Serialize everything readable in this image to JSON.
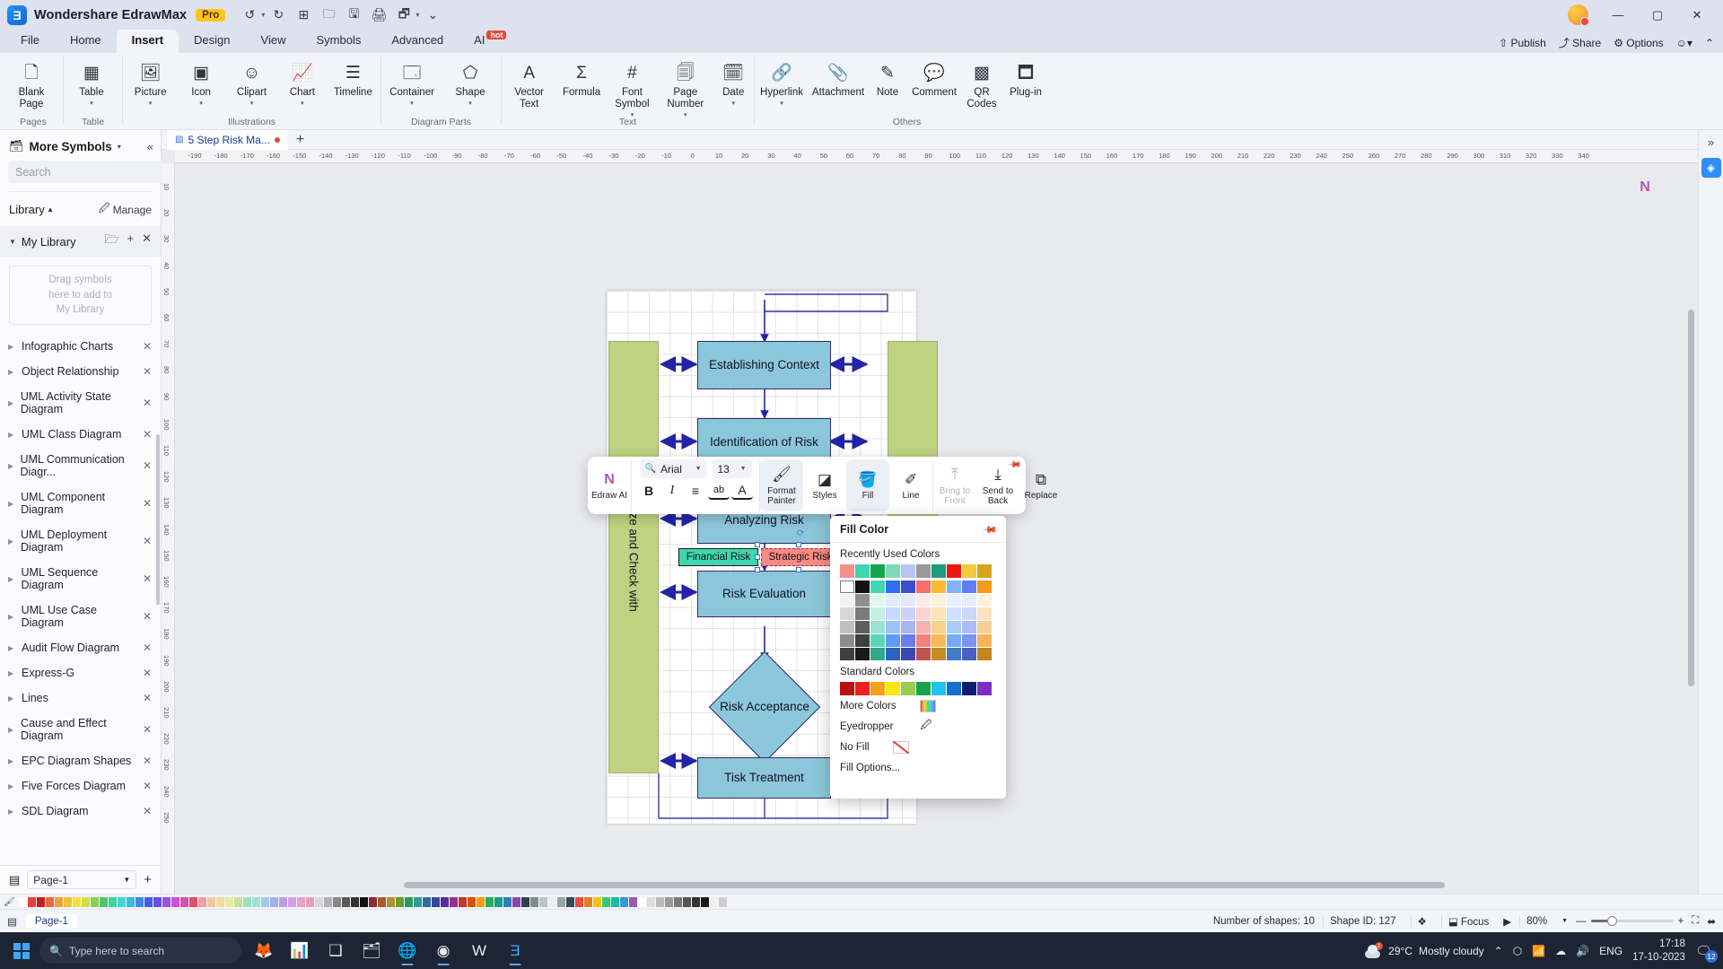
{
  "titlebar": {
    "app_name": "Wondershare EdrawMax",
    "pro_badge": "Pro",
    "quick_actions": [
      "undo-icon",
      "redo-icon",
      "new-icon",
      "open-icon",
      "save-icon",
      "print-icon",
      "export-icon",
      "more-icon"
    ],
    "window_buttons": [
      "minimize",
      "maximize",
      "close"
    ]
  },
  "menu": {
    "tabs": [
      {
        "label": "File",
        "active": false
      },
      {
        "label": "Home",
        "active": false
      },
      {
        "label": "Insert",
        "active": true
      },
      {
        "label": "Design",
        "active": false
      },
      {
        "label": "View",
        "active": false
      },
      {
        "label": "Symbols",
        "active": false
      },
      {
        "label": "Advanced",
        "active": false
      },
      {
        "label": "AI",
        "active": false,
        "badge": "hot"
      }
    ],
    "right_actions": [
      "Publish",
      "Share",
      "Options"
    ]
  },
  "ribbon": {
    "groups": [
      {
        "name": "Pages",
        "items": [
          {
            "label": "Blank\nPage",
            "icon": "blank-page-icon",
            "dropdown": true
          }
        ]
      },
      {
        "name": "Table",
        "items": [
          {
            "label": "Table",
            "icon": "table-icon",
            "dropdown": true
          }
        ]
      },
      {
        "name": "Illustrations",
        "items": [
          {
            "label": "Picture",
            "icon": "picture-icon",
            "dropdown": true
          },
          {
            "label": "Icon",
            "icon": "icon-icon",
            "dropdown": true
          },
          {
            "label": "Clipart",
            "icon": "clipart-icon",
            "dropdown": true
          },
          {
            "label": "Chart",
            "icon": "chart-icon",
            "dropdown": true
          },
          {
            "label": "Timeline",
            "icon": "timeline-icon",
            "dropdown": false
          }
        ]
      },
      {
        "name": "Diagram Parts",
        "items": [
          {
            "label": "Container",
            "icon": "container-icon",
            "dropdown": true
          },
          {
            "label": "Shape",
            "icon": "shape-icon",
            "dropdown": true
          }
        ]
      },
      {
        "name": "Text",
        "items": [
          {
            "label": "Vector\nText",
            "icon": "vector-text-icon",
            "dropdown": false
          },
          {
            "label": "Formula",
            "icon": "formula-icon",
            "dropdown": false
          },
          {
            "label": "Font\nSymbol",
            "icon": "font-symbol-icon",
            "dropdown": true
          },
          {
            "label": "Page\nNumber",
            "icon": "page-number-icon",
            "dropdown": true
          },
          {
            "label": "Date",
            "icon": "date-icon",
            "dropdown": true
          }
        ]
      },
      {
        "name": "Others",
        "items": [
          {
            "label": "Hyperlink",
            "icon": "hyperlink-icon",
            "dropdown": true
          },
          {
            "label": "Attachment",
            "icon": "attachment-icon",
            "dropdown": false
          },
          {
            "label": "Note",
            "icon": "note-icon",
            "dropdown": false
          },
          {
            "label": "Comment",
            "icon": "comment-icon",
            "dropdown": false
          },
          {
            "label": "QR\nCodes",
            "icon": "qr-code-icon",
            "dropdown": false
          },
          {
            "label": "Plug-in",
            "icon": "plugin-icon",
            "dropdown": false
          }
        ]
      }
    ]
  },
  "sidebar": {
    "title": "More Symbols",
    "search_placeholder": "Search",
    "search_value": "",
    "search_button": "Search",
    "library_label": "Library",
    "manage_label": "Manage",
    "my_library_label": "My Library",
    "drop_hint": "Drag symbols\nhere to add to\nMy Library",
    "items": [
      {
        "label": "Infographic Charts"
      },
      {
        "label": "Object Relationship"
      },
      {
        "label": "UML Activity State Diagram"
      },
      {
        "label": "UML Class Diagram"
      },
      {
        "label": "UML Communication Diagr..."
      },
      {
        "label": "UML Component Diagram"
      },
      {
        "label": "UML Deployment Diagram"
      },
      {
        "label": "UML Sequence Diagram"
      },
      {
        "label": "UML Use Case Diagram"
      },
      {
        "label": "Audit Flow Diagram"
      },
      {
        "label": "Express-G"
      },
      {
        "label": "Lines"
      },
      {
        "label": "Cause and Effect Diagram"
      },
      {
        "label": "EPC Diagram Shapes"
      },
      {
        "label": "Five Forces Diagram"
      },
      {
        "label": "SDL Diagram"
      }
    ],
    "footer_page": "Page-1"
  },
  "document": {
    "tab_title": "5 Step Risk Ma...",
    "modified": true
  },
  "diagram": {
    "nodes": [
      {
        "label": "Establishing Context",
        "type": "process"
      },
      {
        "label": "Identification of Risk",
        "type": "process"
      },
      {
        "label": "Analyzing Risk",
        "type": "process"
      },
      {
        "label": "Risk Evaluation",
        "type": "process"
      },
      {
        "label": "Risk Acceptance",
        "type": "decision"
      },
      {
        "label": "Tisk Treatment",
        "type": "process"
      }
    ],
    "side_band_left": "nize and Check with",
    "tags": [
      {
        "label": "Financial Risk",
        "color": "#3fd6b0",
        "selected": false
      },
      {
        "label": "Strategic Risk",
        "color": "#f98a85",
        "selected": true
      }
    ]
  },
  "format_toolbar": {
    "edraw_ai": "Edraw AI",
    "font_family": "Arial",
    "font_size": "13",
    "buttons": [
      {
        "name": "bold",
        "glyph": "B"
      },
      {
        "name": "italic",
        "glyph": "I"
      },
      {
        "name": "align",
        "glyph": "≡"
      },
      {
        "name": "text-case",
        "glyph": "ab"
      },
      {
        "name": "font-color",
        "glyph": "A"
      }
    ],
    "tools": [
      {
        "label": "Format\nPainter",
        "icon": "format-painter-icon",
        "disabled": false
      },
      {
        "label": "Styles",
        "icon": "styles-icon",
        "disabled": false
      },
      {
        "label": "Fill",
        "icon": "fill-icon",
        "disabled": false
      },
      {
        "label": "Line",
        "icon": "line-icon",
        "disabled": false
      },
      {
        "label": "Bring to\nFront",
        "icon": "bring-to-front-icon",
        "disabled": true
      },
      {
        "label": "Send to\nBack",
        "icon": "send-to-back-icon",
        "disabled": false
      },
      {
        "label": "Replace",
        "icon": "replace-icon",
        "disabled": false
      }
    ]
  },
  "fill_panel": {
    "title": "Fill Color",
    "recently_used_label": "Recently Used Colors",
    "recently_used": [
      "#f58f8a",
      "#3fd6b0",
      "#16a44e",
      "#7fd9bb",
      "#b6c8f2",
      "#9a9a9a",
      "#1f9b7d",
      "#f01515",
      "#f5c93e",
      "#d6a422"
    ],
    "theme_colors_row1": [
      "#ffffff",
      "#111111",
      "#3fd6b0",
      "#2f6ff0",
      "#3a4fd0",
      "#f5706a",
      "#f5bc34",
      "#7fb3f5",
      "#5f7ef5",
      "#f59a1c"
    ],
    "theme_tints": [
      [
        "#f2f2f2",
        "#8f8f8f",
        "#e3f7f1",
        "#e2ecff",
        "#e5e8fb",
        "#fde9e8",
        "#fdf1da",
        "#e7f0fd",
        "#e6eafd",
        "#fdf0de"
      ],
      [
        "#d8d8d8",
        "#7a7a7a",
        "#c6efe3",
        "#c5daff",
        "#ccd2f7",
        "#fbd3d1",
        "#fbe4b6",
        "#cfe1fb",
        "#cdd5fb",
        "#fbe1bd"
      ],
      [
        "#bfbfbf",
        "#5e5e5e",
        "#9ae3cf",
        "#9cc3fa",
        "#a9b5f1",
        "#f8b2ae",
        "#f8d28d",
        "#aacdf8",
        "#abbcf8",
        "#f8cf92"
      ],
      [
        "#8c8c8c",
        "#3f3f3f",
        "#5ed6b6",
        "#5e9bf5",
        "#6a7ee8",
        "#f4817b",
        "#f4bb55",
        "#76abf4",
        "#7a93f4",
        "#f4b457"
      ],
      [
        "#3f3f3f",
        "#1a1a1a",
        "#2da98b",
        "#2c62c4",
        "#3a48b4",
        "#c4524c",
        "#c48d24",
        "#3f7cc4",
        "#4a5fc4",
        "#c4861c"
      ]
    ],
    "standard_label": "Standard Colors",
    "standard_colors": [
      "#b91010",
      "#ef2020",
      "#f5a01a",
      "#f7e614",
      "#9acc4f",
      "#17a44a",
      "#1fc4ef",
      "#1470c8",
      "#0d1f6e",
      "#7b2fc4"
    ],
    "more_colors": "More Colors",
    "eyedropper": "Eyedropper",
    "no_fill": "No Fill",
    "fill_options": "Fill Options..."
  },
  "color_strip": {
    "colors": [
      "#ffffff",
      "#e84040",
      "#c41f1f",
      "#e8683f",
      "#f0a03a",
      "#f2c13c",
      "#f6e03d",
      "#cfe04a",
      "#8ad14f",
      "#4fc46c",
      "#3fd1a8",
      "#3fd6d6",
      "#3fb8e0",
      "#3f8ae0",
      "#3f5ee0",
      "#6a4fe0",
      "#9a4fe0",
      "#cc4fd6",
      "#e04fa8",
      "#e04f6a",
      "#f0a0a0",
      "#f0c8a0",
      "#f2dca0",
      "#e8eaa0",
      "#c4e0a0",
      "#a0e0b8",
      "#a0e0da",
      "#a0cce8",
      "#a0b0e8",
      "#b8a0e8",
      "#d4a0e8",
      "#e8a0d0",
      "#e8a0b4",
      "#d8d8d8",
      "#b0b0b0",
      "#888888",
      "#5a5a5a",
      "#333333",
      "#111111",
      "#8b2e2e",
      "#a85a2e",
      "#b5902e",
      "#6f9a2e",
      "#2e9a5a",
      "#2e9a9a",
      "#2e6f9a",
      "#2e4a9a",
      "#5a2e9a",
      "#9a2e8b",
      "#c0392b",
      "#d35400",
      "#f39c12",
      "#27ae60",
      "#16a085",
      "#2980b9",
      "#8e44ad",
      "#2c3e50",
      "#7f8c8d",
      "#bdc3c7",
      "#ecf0f1",
      "#95a5a6",
      "#34495e",
      "#e74c3c",
      "#e67e22",
      "#f1c40f",
      "#2ecc71",
      "#1abc9c",
      "#3498db",
      "#9b59b6",
      "#ffffff",
      "#dddddd",
      "#bbbbbb",
      "#999999",
      "#777777",
      "#555555",
      "#333333",
      "#1a1a1a",
      "#efefef",
      "#cfcfcf"
    ]
  },
  "status_bar": {
    "shape_count": "Number of shapes: 10",
    "shape_id": "Shape ID: 127",
    "focus_label": "Focus",
    "zoom_level": "80%",
    "page_tab": "Page-1"
  },
  "taskbar": {
    "search_placeholder": "Type here to search",
    "weather_temp": "29°C",
    "weather_desc": "Mostly cloudy",
    "language": "ENG",
    "time": "17:18",
    "date": "17-10-2023",
    "notification_count": "12"
  },
  "rulers": {
    "h_ticks": [
      "-190",
      "-180",
      "-170",
      "-160",
      "-150",
      "-140",
      "-130",
      "-120",
      "-110",
      "-100",
      "-90",
      "-80",
      "-70",
      "-60",
      "-50",
      "-40",
      "-30",
      "-20",
      "-10",
      "0",
      "10",
      "20",
      "30",
      "40",
      "50",
      "60",
      "70",
      "80",
      "90",
      "100",
      "110",
      "120",
      "130",
      "140",
      "150",
      "160",
      "170",
      "180",
      "190",
      "200",
      "210",
      "220",
      "230",
      "240",
      "250",
      "260",
      "270",
      "280",
      "290",
      "300",
      "310",
      "320",
      "330",
      "340"
    ],
    "v_ticks": [
      "10",
      "20",
      "30",
      "40",
      "50",
      "60",
      "70",
      "80",
      "90",
      "100",
      "110",
      "120",
      "130",
      "140",
      "150",
      "160",
      "170",
      "180",
      "190",
      "200",
      "210",
      "220",
      "230",
      "240",
      "250"
    ]
  }
}
